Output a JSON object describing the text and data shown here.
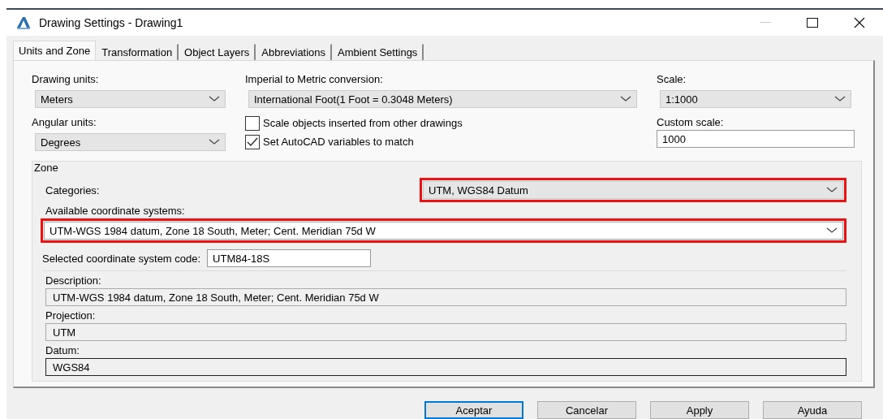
{
  "window": {
    "title": "Drawing Settings - Drawing1"
  },
  "tabs": [
    {
      "label": "Units and Zone",
      "selected": true
    },
    {
      "label": "Transformation",
      "selected": false
    },
    {
      "label": "Object Layers",
      "selected": false
    },
    {
      "label": "Abbreviations",
      "selected": false
    },
    {
      "label": "Ambient Settings",
      "selected": false
    }
  ],
  "units": {
    "drawing_units": {
      "label": "Drawing units:",
      "value": "Meters"
    },
    "angular_units": {
      "label": "Angular units:",
      "value": "Degrees"
    },
    "conversion": {
      "label": "Imperial to Metric conversion:",
      "value": "International Foot(1 Foot = 0.3048 Meters)"
    },
    "checkboxes": [
      {
        "label": "Scale objects inserted from other drawings",
        "checked": false
      },
      {
        "label": "Set AutoCAD variables to match",
        "checked": true
      }
    ],
    "scale": {
      "label": "Scale:",
      "value": "1:1000"
    },
    "custom_scale": {
      "label": "Custom scale:",
      "value": "1000"
    }
  },
  "zone": {
    "title": "Zone",
    "categories": {
      "label": "Categories:",
      "value": "UTM, WGS84 Datum",
      "highlighted": true
    },
    "available": {
      "label": "Available coordinate systems:",
      "value": "UTM-WGS 1984 datum, Zone 18 South, Meter; Cent. Meridian 75d W",
      "highlighted": true
    },
    "code": {
      "label": "Selected coordinate system code:",
      "value": "UTM84-18S"
    },
    "fields": [
      {
        "label": "Description:",
        "value": "UTM-WGS 1984 datum, Zone 18 South, Meter; Cent. Meridian 75d W",
        "focused": false
      },
      {
        "label": "Projection:",
        "value": "UTM",
        "focused": false
      },
      {
        "label": "Datum:",
        "value": "WGS84",
        "focused": true
      }
    ]
  },
  "buttons": [
    {
      "label": "Aceptar",
      "default": true
    },
    {
      "label": "Cancelar",
      "default": false
    },
    {
      "label": "Apply",
      "default": false
    },
    {
      "label": "Ayuda",
      "default": false
    }
  ]
}
